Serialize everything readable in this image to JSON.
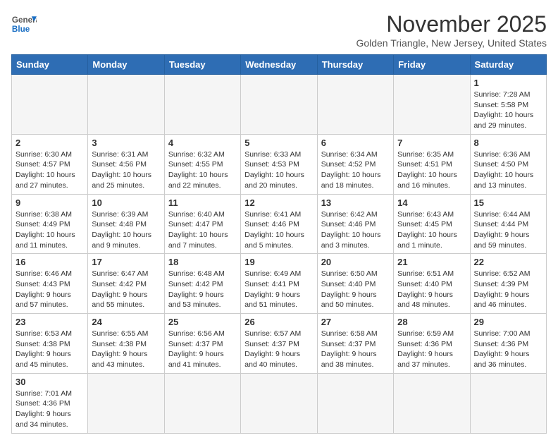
{
  "logo": {
    "line1": "General",
    "line2": "Blue"
  },
  "title": "November 2025",
  "location": "Golden Triangle, New Jersey, United States",
  "days_of_week": [
    "Sunday",
    "Monday",
    "Tuesday",
    "Wednesday",
    "Thursday",
    "Friday",
    "Saturday"
  ],
  "weeks": [
    [
      {
        "day": "",
        "info": ""
      },
      {
        "day": "",
        "info": ""
      },
      {
        "day": "",
        "info": ""
      },
      {
        "day": "",
        "info": ""
      },
      {
        "day": "",
        "info": ""
      },
      {
        "day": "",
        "info": ""
      },
      {
        "day": "1",
        "info": "Sunrise: 7:28 AM\nSunset: 5:58 PM\nDaylight: 10 hours and 29 minutes."
      }
    ],
    [
      {
        "day": "2",
        "info": "Sunrise: 6:30 AM\nSunset: 4:57 PM\nDaylight: 10 hours and 27 minutes."
      },
      {
        "day": "3",
        "info": "Sunrise: 6:31 AM\nSunset: 4:56 PM\nDaylight: 10 hours and 25 minutes."
      },
      {
        "day": "4",
        "info": "Sunrise: 6:32 AM\nSunset: 4:55 PM\nDaylight: 10 hours and 22 minutes."
      },
      {
        "day": "5",
        "info": "Sunrise: 6:33 AM\nSunset: 4:53 PM\nDaylight: 10 hours and 20 minutes."
      },
      {
        "day": "6",
        "info": "Sunrise: 6:34 AM\nSunset: 4:52 PM\nDaylight: 10 hours and 18 minutes."
      },
      {
        "day": "7",
        "info": "Sunrise: 6:35 AM\nSunset: 4:51 PM\nDaylight: 10 hours and 16 minutes."
      },
      {
        "day": "8",
        "info": "Sunrise: 6:36 AM\nSunset: 4:50 PM\nDaylight: 10 hours and 13 minutes."
      }
    ],
    [
      {
        "day": "9",
        "info": "Sunrise: 6:38 AM\nSunset: 4:49 PM\nDaylight: 10 hours and 11 minutes."
      },
      {
        "day": "10",
        "info": "Sunrise: 6:39 AM\nSunset: 4:48 PM\nDaylight: 10 hours and 9 minutes."
      },
      {
        "day": "11",
        "info": "Sunrise: 6:40 AM\nSunset: 4:47 PM\nDaylight: 10 hours and 7 minutes."
      },
      {
        "day": "12",
        "info": "Sunrise: 6:41 AM\nSunset: 4:46 PM\nDaylight: 10 hours and 5 minutes."
      },
      {
        "day": "13",
        "info": "Sunrise: 6:42 AM\nSunset: 4:46 PM\nDaylight: 10 hours and 3 minutes."
      },
      {
        "day": "14",
        "info": "Sunrise: 6:43 AM\nSunset: 4:45 PM\nDaylight: 10 hours and 1 minute."
      },
      {
        "day": "15",
        "info": "Sunrise: 6:44 AM\nSunset: 4:44 PM\nDaylight: 9 hours and 59 minutes."
      }
    ],
    [
      {
        "day": "16",
        "info": "Sunrise: 6:46 AM\nSunset: 4:43 PM\nDaylight: 9 hours and 57 minutes."
      },
      {
        "day": "17",
        "info": "Sunrise: 6:47 AM\nSunset: 4:42 PM\nDaylight: 9 hours and 55 minutes."
      },
      {
        "day": "18",
        "info": "Sunrise: 6:48 AM\nSunset: 4:42 PM\nDaylight: 9 hours and 53 minutes."
      },
      {
        "day": "19",
        "info": "Sunrise: 6:49 AM\nSunset: 4:41 PM\nDaylight: 9 hours and 51 minutes."
      },
      {
        "day": "20",
        "info": "Sunrise: 6:50 AM\nSunset: 4:40 PM\nDaylight: 9 hours and 50 minutes."
      },
      {
        "day": "21",
        "info": "Sunrise: 6:51 AM\nSunset: 4:40 PM\nDaylight: 9 hours and 48 minutes."
      },
      {
        "day": "22",
        "info": "Sunrise: 6:52 AM\nSunset: 4:39 PM\nDaylight: 9 hours and 46 minutes."
      }
    ],
    [
      {
        "day": "23",
        "info": "Sunrise: 6:53 AM\nSunset: 4:38 PM\nDaylight: 9 hours and 45 minutes."
      },
      {
        "day": "24",
        "info": "Sunrise: 6:55 AM\nSunset: 4:38 PM\nDaylight: 9 hours and 43 minutes."
      },
      {
        "day": "25",
        "info": "Sunrise: 6:56 AM\nSunset: 4:37 PM\nDaylight: 9 hours and 41 minutes."
      },
      {
        "day": "26",
        "info": "Sunrise: 6:57 AM\nSunset: 4:37 PM\nDaylight: 9 hours and 40 minutes."
      },
      {
        "day": "27",
        "info": "Sunrise: 6:58 AM\nSunset: 4:37 PM\nDaylight: 9 hours and 38 minutes."
      },
      {
        "day": "28",
        "info": "Sunrise: 6:59 AM\nSunset: 4:36 PM\nDaylight: 9 hours and 37 minutes."
      },
      {
        "day": "29",
        "info": "Sunrise: 7:00 AM\nSunset: 4:36 PM\nDaylight: 9 hours and 36 minutes."
      }
    ],
    [
      {
        "day": "30",
        "info": "Sunrise: 7:01 AM\nSunset: 4:36 PM\nDaylight: 9 hours and 34 minutes."
      },
      {
        "day": "",
        "info": ""
      },
      {
        "day": "",
        "info": ""
      },
      {
        "day": "",
        "info": ""
      },
      {
        "day": "",
        "info": ""
      },
      {
        "day": "",
        "info": ""
      },
      {
        "day": "",
        "info": ""
      }
    ]
  ]
}
